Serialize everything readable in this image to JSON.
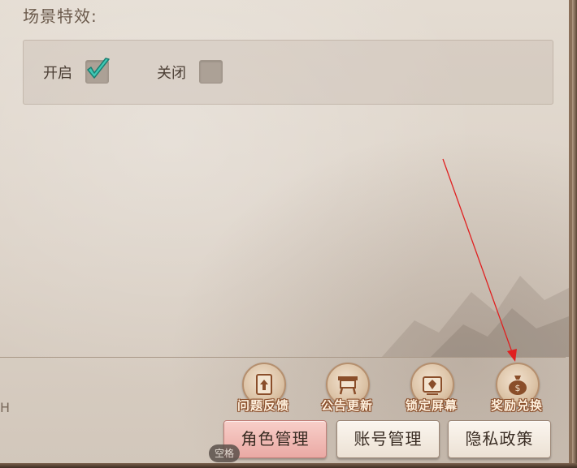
{
  "scene_effects": {
    "title": "场景特效:",
    "options": [
      {
        "label": "开启",
        "checked": true
      },
      {
        "label": "关闭",
        "checked": false
      }
    ]
  },
  "left_glyph": "H",
  "icon_buttons": [
    {
      "label": "问题反馈",
      "icon": "feedback-document-icon"
    },
    {
      "label": "公告更新",
      "icon": "notice-board-icon"
    },
    {
      "label": "锁定屏幕",
      "icon": "lock-screen-icon"
    },
    {
      "label": "奖励兑换",
      "icon": "money-bag-icon"
    }
  ],
  "bottom_buttons": [
    {
      "label": "角色管理",
      "active": true
    },
    {
      "label": "账号管理",
      "active": false
    },
    {
      "label": "隐私政策",
      "active": false
    }
  ],
  "key_hint": "空格",
  "colors": {
    "active_button": "#eaa9a4",
    "check_mark": "#3fc9b5",
    "arrow": "#e02020"
  }
}
